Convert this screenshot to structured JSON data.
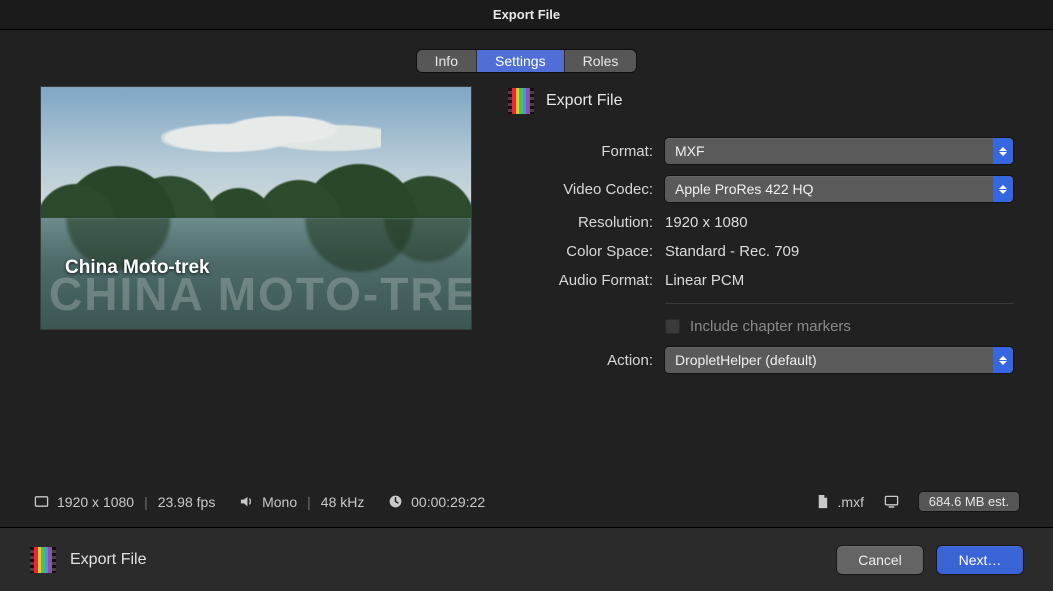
{
  "window": {
    "title": "Export File"
  },
  "tabs": {
    "info": "Info",
    "settings": "Settings",
    "roles": "Roles",
    "active": "settings"
  },
  "section": {
    "title": "Export File"
  },
  "preview": {
    "caption": "China Moto-trek",
    "watermark": "CHINA MOTO-TREK"
  },
  "labels": {
    "format": "Format:",
    "video_codec": "Video Codec:",
    "resolution": "Resolution:",
    "color_space": "Color Space:",
    "audio_format": "Audio Format:",
    "chapter_markers": "Include chapter markers",
    "action": "Action:"
  },
  "values": {
    "format": "MXF",
    "video_codec": "Apple ProRes 422 HQ",
    "resolution": "1920 x 1080",
    "color_space": "Standard - Rec. 709",
    "audio_format": "Linear PCM",
    "chapter_markers_checked": false,
    "action": "DropletHelper (default)"
  },
  "status": {
    "dimensions": "1920 x 1080",
    "fps": "23.98 fps",
    "audio_channels": "Mono",
    "audio_rate": "48 kHz",
    "duration": "00:00:29:22",
    "file_ext": ".mxf",
    "size_est": "684.6 MB est."
  },
  "footer": {
    "title": "Export File",
    "cancel": "Cancel",
    "next": "Next…"
  }
}
